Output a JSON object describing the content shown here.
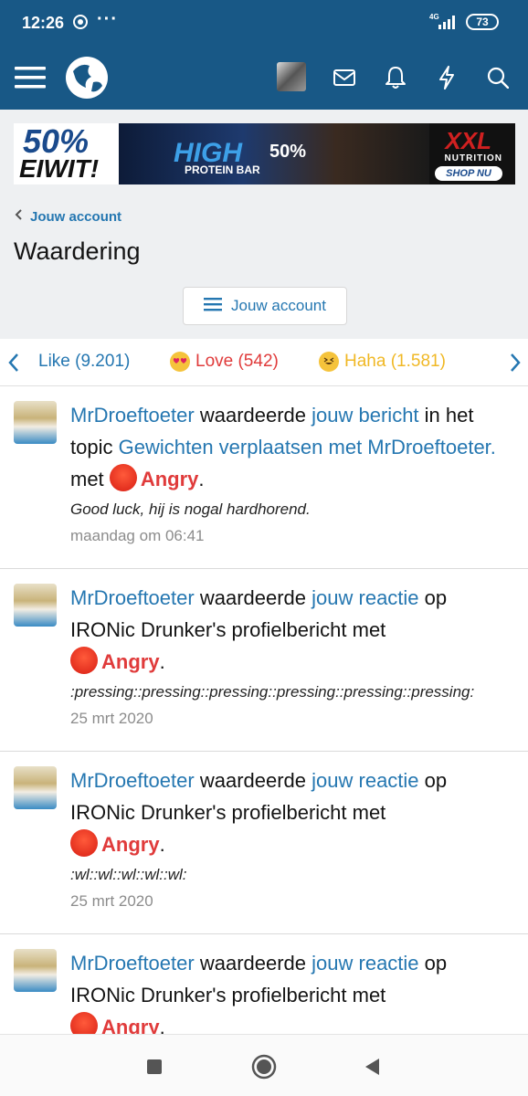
{
  "status_bar": {
    "time": "12:26",
    "network": "4G",
    "battery": "73"
  },
  "header": {
    "menu_icon": "hamburger-icon",
    "logo_icon": "globe-logo",
    "icons": [
      "avatar",
      "envelope-icon",
      "bell-icon",
      "bolt-icon",
      "search-icon"
    ]
  },
  "banner": {
    "big": "50%",
    "small": "EIWIT!",
    "product": "HIGH",
    "product_sub": "PROTEIN BAR",
    "product_pct": "50%",
    "brand": "XXL",
    "brand_sub": "NUTRITION",
    "cta": "SHOP NU"
  },
  "breadcrumb": {
    "label": "Jouw account"
  },
  "page_title": "Waardering",
  "account_button": {
    "label": "Jouw account"
  },
  "tabs": [
    {
      "label": "Like (9.201)",
      "color": "#2577b1"
    },
    {
      "label": "Love (542)",
      "color": "#e03b3b"
    },
    {
      "label": "Haha (1.581)",
      "color": "#f0b825"
    }
  ],
  "feed": [
    {
      "user": "MrDroeftoeter",
      "verb": "waardeerde",
      "target": "jouw bericht",
      "mid": "in het topic",
      "topic": "Gewichten verplaatsen met MrDroeftoeter.",
      "with": "met",
      "reaction": "Angry",
      "snippet": "Good luck, hij is nogal hardhorend.",
      "time": "maandag om 06:41"
    },
    {
      "user": "MrDroeftoeter",
      "verb": "waardeerde",
      "target": "jouw reactie",
      "mid": "op IRONic Drunker's profielbericht met",
      "reaction": "Angry",
      "snippet": ":pressing::pressing::pressing::pressing::pressing::pressing:",
      "time": "25 mrt 2020"
    },
    {
      "user": "MrDroeftoeter",
      "verb": "waardeerde",
      "target": "jouw reactie",
      "mid": "op IRONic Drunker's profielbericht met",
      "reaction": "Angry",
      "snippet": ":wl::wl::wl::wl::wl:",
      "time": "25 mrt 2020"
    },
    {
      "user": "MrDroeftoeter",
      "verb": "waardeerde",
      "target": "jouw reactie",
      "mid": "op IRONic Drunker's profielbericht met",
      "reaction": "Angry"
    }
  ]
}
